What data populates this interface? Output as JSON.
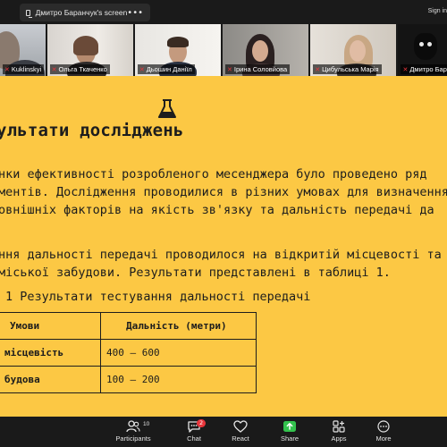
{
  "topbar": {
    "share_label": "Дмитро Баранчук's screen",
    "options_glyph": "•••",
    "signin": "Sign in"
  },
  "participants_strip": [
    {
      "name": "Kuklinskyi",
      "muted": true,
      "active": false
    },
    {
      "name": "Ольга Ткаченко",
      "muted": true,
      "active": false
    },
    {
      "name": "Дьошин Даніїл",
      "muted": true,
      "active": false
    },
    {
      "name": "Ірина Соловйова",
      "muted": true,
      "active": false
    },
    {
      "name": "Цибульська Марія",
      "muted": true,
      "active": false
    },
    {
      "name": "Дмитро Баранчук",
      "muted": true,
      "active": true
    }
  ],
  "slide": {
    "icon": "flask-icon",
    "title": "ультати досліджень",
    "paragraph1": [
      "нки ефективності розробленого месенджера було проведено ряд",
      "ментів.  Дослідження проводилися в різних умовах для визначення",
      "овнішніх факторів на якість зв'язку та дальність передачі да"
    ],
    "paragraph2": [
      "ння дальності передачі проводилося на відкритій місцевості та",
      "міської забудови.  Результати представлені в таблиці 1."
    ],
    "table_caption": "1 Результати тестування дальності передачі",
    "table": {
      "headers": [
        "Умови",
        "Дальність (метри)"
      ],
      "rows": [
        [
          "місцевість",
          "400 – 600"
        ],
        [
          "будова",
          "100 – 200"
        ]
      ]
    },
    "background": "#fcc844"
  },
  "toolbar": {
    "participants": {
      "label": "Participants",
      "count": "10"
    },
    "chat": {
      "label": "Chat",
      "badge": "2"
    },
    "react": {
      "label": "React"
    },
    "share": {
      "label": "Share"
    },
    "apps": {
      "label": "Apps"
    },
    "more": {
      "label": "More"
    }
  },
  "colors": {
    "accent_green": "#33c24d",
    "muted_red": "#e8353b"
  }
}
